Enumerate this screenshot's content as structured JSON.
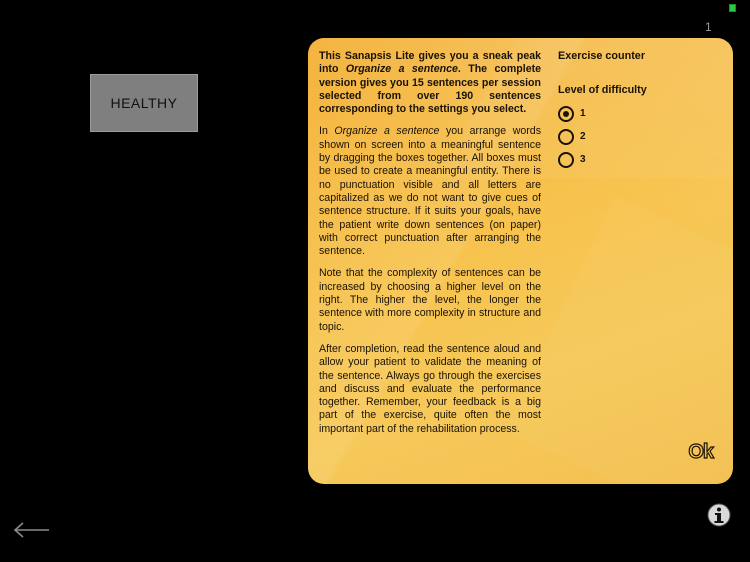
{
  "status": {
    "counter_number": "1"
  },
  "word_card": {
    "label": "HEALTHY"
  },
  "panel": {
    "description": {
      "p1_parts": [
        "This Sanapsis Lite gives you a sneak peak into ",
        "Organize a sentence",
        ". The complete version gives you 15 sentences per session selected from over 190 sentences corresponding to the settings you select."
      ],
      "p2_parts": [
        "In ",
        "Organize a sentence",
        " you arrange words shown on screen into a meaningful sentence by dragging the boxes together. All boxes must be used to create a meaningful entity. There is no punctuation visible and all letters are capitalized as we do not want to give cues of sentence structure. If it suits your goals, have the patient write down sentences (on paper) with correct punctuation after arranging the sentence."
      ],
      "p3": "Note that the complexity of sentences can be increased by choosing a higher level on the right. The higher the level, the longer the sentence with more complexity in structure and topic.",
      "p4": "After completion, read the sentence aloud and allow your patient to validate the meaning of the sentence. Always go through the exercises and discuss and evaluate the performance together. Remember, your feedback is a big part of the exercise, quite often the most important part of the rehabilitation process."
    },
    "settings": {
      "exercise_counter_label": "Exercise counter",
      "difficulty_label": "Level of difficulty",
      "levels": [
        "1",
        "2",
        "3"
      ],
      "selected_level": "1"
    },
    "ok_label": "Ok"
  },
  "icons": {
    "back": "back-arrow-icon",
    "info": "info-icon"
  },
  "colors": {
    "background": "#000000",
    "panel_accent": "#f5c24a",
    "card": "#7f7f7f"
  }
}
